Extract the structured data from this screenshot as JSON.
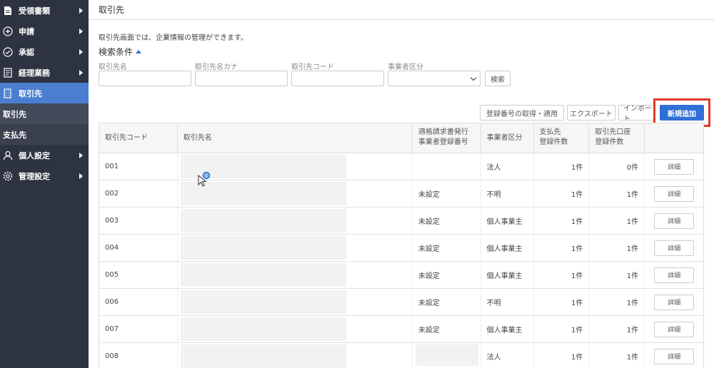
{
  "sidebar": {
    "items": [
      {
        "label": "受領書類",
        "icon": "document-icon",
        "arrow": true
      },
      {
        "label": "申請",
        "icon": "plus-circle-icon",
        "arrow": true
      },
      {
        "label": "承認",
        "icon": "check-circle-icon",
        "arrow": true
      },
      {
        "label": "経理業務",
        "icon": "ledger-icon",
        "arrow": true
      },
      {
        "label": "取引先",
        "icon": "building-icon",
        "arrow": false,
        "active": true
      }
    ],
    "sub_items": [
      {
        "label": "取引先"
      },
      {
        "label": "支払先"
      }
    ],
    "bottom_items": [
      {
        "label": "個人設定",
        "icon": "user-icon",
        "arrow": true
      },
      {
        "label": "管理設定",
        "icon": "gear-icon",
        "arrow": true
      }
    ]
  },
  "header": {
    "title": "取引先"
  },
  "description": "取引先画面では、企業情報の管理ができます。",
  "search": {
    "title": "検索条件",
    "fields": [
      {
        "label": "取引先名",
        "value": ""
      },
      {
        "label": "取引先名カナ",
        "value": ""
      },
      {
        "label": "取引先コード",
        "value": ""
      },
      {
        "label": "事業者区分",
        "value": ""
      }
    ],
    "search_button": "検索"
  },
  "toolbar": {
    "registration_button": "登録番号の取得・適用",
    "export_button": "エクスポート",
    "import_button": "インポート",
    "new_button": "新規追加"
  },
  "table": {
    "headers": [
      "取引先コード",
      "取引先名",
      "適格請求書発行\n事業者登録番号",
      "事業者区分",
      "支払先\n登録件数",
      "取引先口座\n登録件数",
      ""
    ],
    "detail_label": "詳細",
    "rows": [
      {
        "code": "001",
        "reg": "",
        "type": "法人",
        "payees": "1件",
        "accounts": "0件"
      },
      {
        "code": "002",
        "reg": "未設定",
        "type": "不明",
        "payees": "1件",
        "accounts": "1件"
      },
      {
        "code": "003",
        "reg": "未設定",
        "type": "個人事業主",
        "payees": "1件",
        "accounts": "1件"
      },
      {
        "code": "004",
        "reg": "未設定",
        "type": "個人事業主",
        "payees": "1件",
        "accounts": "1件"
      },
      {
        "code": "005",
        "reg": "未設定",
        "type": "個人事業主",
        "payees": "1件",
        "accounts": "1件"
      },
      {
        "code": "006",
        "reg": "未設定",
        "type": "不明",
        "payees": "1件",
        "accounts": "1件"
      },
      {
        "code": "007",
        "reg": "未設定",
        "type": "個人事業主",
        "payees": "1件",
        "accounts": "1件"
      },
      {
        "code": "008",
        "reg": "",
        "type": "法人",
        "payees": "1件",
        "accounts": "1件"
      }
    ]
  },
  "colors": {
    "sidebar_bg": "#2d3340",
    "active": "#4a7fd0",
    "primary": "#2f6fd6",
    "highlight": "#e23a2a"
  }
}
